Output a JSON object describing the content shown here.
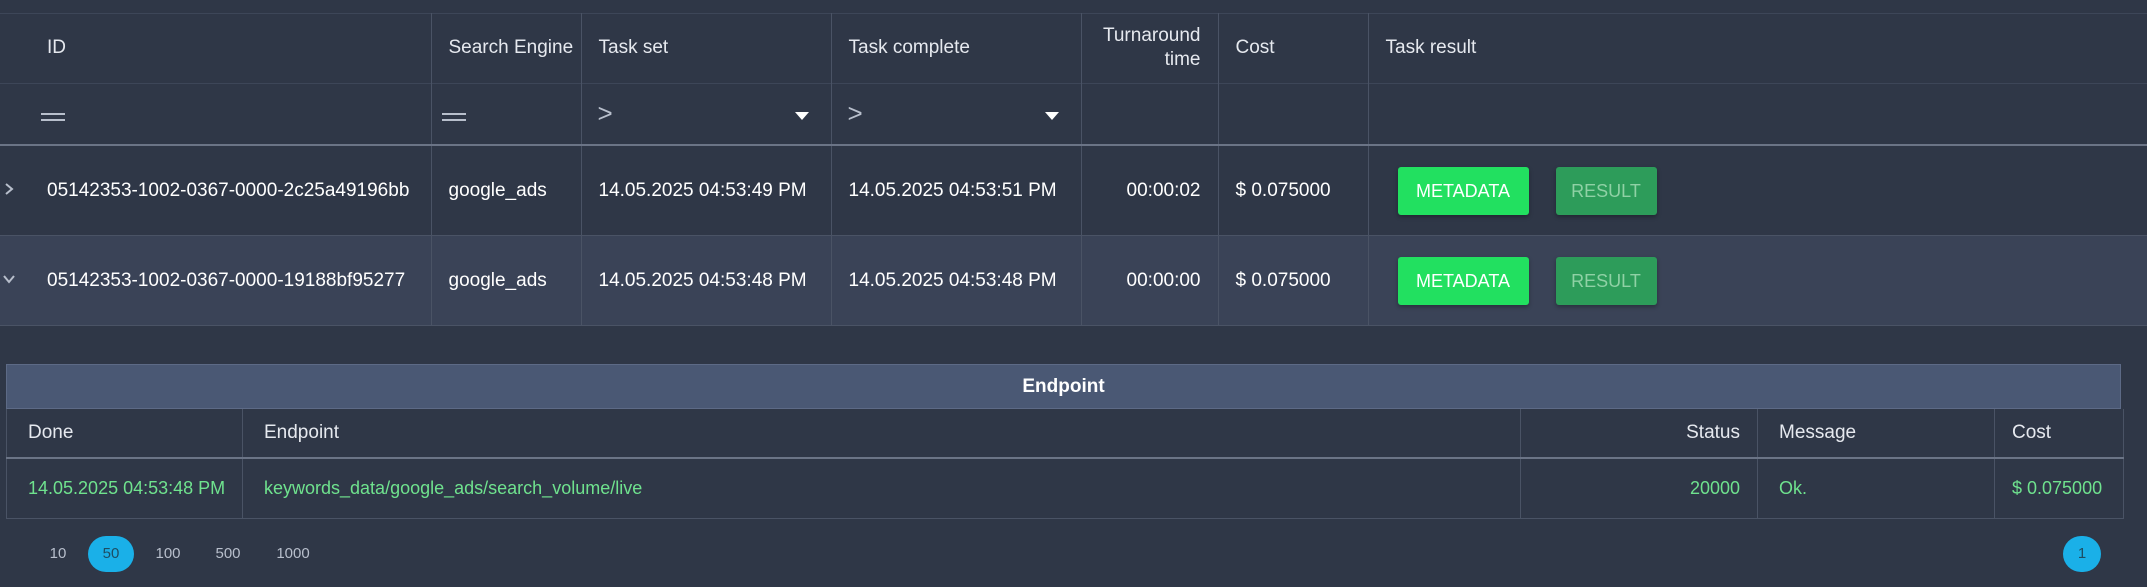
{
  "table": {
    "columns": {
      "id": "ID",
      "search_engine": "Search Engine",
      "task_set": "Task set",
      "task_complete": "Task complete",
      "turnaround_1": "Turnaround",
      "turnaround_2": "time",
      "cost": "Cost",
      "task_result": "Task result"
    },
    "filters": {
      "task_set_op": ">",
      "task_complete_op": ">"
    },
    "rows": [
      {
        "id": "05142353-1002-0367-0000-2c25a49196bb",
        "search_engine": "google_ads",
        "task_set": "14.05.2025 04:53:49 PM",
        "task_complete": "14.05.2025 04:53:51 PM",
        "turnaround": "00:00:02",
        "cost": "$ 0.075000",
        "metadata_label": "METADATA",
        "result_label": "RESULT",
        "expanded": false
      },
      {
        "id": "05142353-1002-0367-0000-19188bf95277",
        "search_engine": "google_ads",
        "task_set": "14.05.2025 04:53:48 PM",
        "task_complete": "14.05.2025 04:53:48 PM",
        "turnaround": "00:00:00",
        "cost": "$ 0.075000",
        "metadata_label": "METADATA",
        "result_label": "RESULT",
        "expanded": true
      }
    ]
  },
  "endpoint_panel": {
    "title": "Endpoint",
    "columns": {
      "done": "Done",
      "endpoint": "Endpoint",
      "status": "Status",
      "message": "Message",
      "cost": "Cost"
    },
    "rows": [
      {
        "done": "14.05.2025 04:53:48 PM",
        "endpoint": "keywords_data/google_ads/search_volume/live",
        "status": "20000",
        "message": "Ok.",
        "cost": "$ 0.075000"
      }
    ]
  },
  "pagination": {
    "page_sizes": [
      "10",
      "50",
      "100",
      "500",
      "1000"
    ],
    "selected_page_size": "50",
    "current_page": "1"
  },
  "colors": {
    "background": "#2f3747",
    "metadata_button": "#22e060",
    "result_button": "#2d9c5a",
    "accent_blue": "#1ab0e8",
    "success_text": "#6fe28e"
  },
  "icons": {
    "row1_toggle": "chevron-right-icon",
    "row2_toggle": "chevron-down-icon",
    "filter_equals": "equals-icon",
    "filter_dropdown": "caret-down-icon"
  }
}
